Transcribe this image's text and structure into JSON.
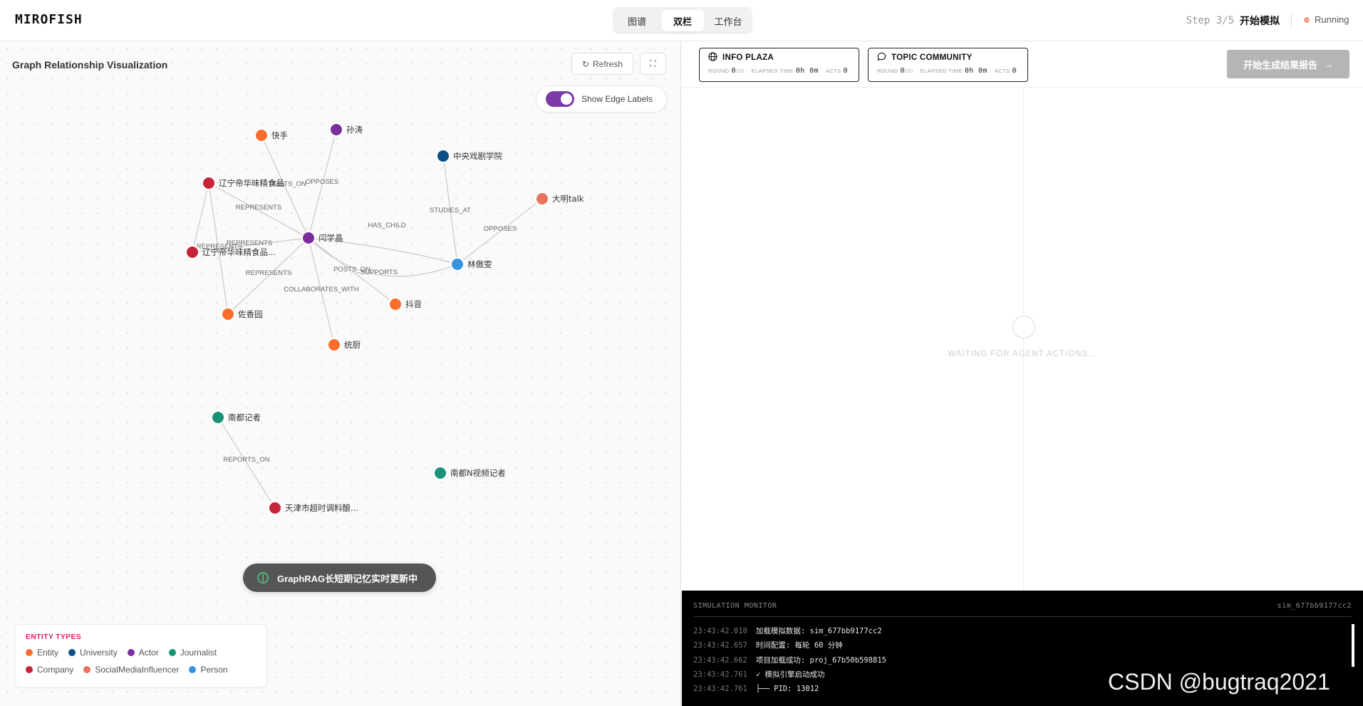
{
  "header": {
    "logo": "MIROFISH",
    "tabs": [
      {
        "label": "图谱"
      },
      {
        "label": "双栏"
      },
      {
        "label": "工作台"
      }
    ],
    "step_number": "Step 3/5",
    "step_name": "开始模拟",
    "status": "Running",
    "status_color": "#f5a08a"
  },
  "graph_panel": {
    "title": "Graph Relationship Visualization",
    "refresh_label": "Refresh",
    "refresh_icon": "refresh-icon",
    "fullscreen_icon": "fullscreen-icon",
    "edge_labels_toggle": "Show Edge Labels",
    "edge_labels_on": true,
    "nodes": [
      {
        "id": "kuaishou",
        "label": "快手",
        "type": "Entity",
        "color": "#fa6d2c"
      },
      {
        "id": "suntao",
        "label": "孙涛",
        "type": "Actor",
        "color": "#7b2d9c"
      },
      {
        "id": "liaoning1",
        "label": "辽宁帝华味精食品",
        "type": "Company",
        "color": "#c7243a"
      },
      {
        "id": "liaoning2",
        "label": "辽宁帝华味精食品...",
        "type": "Company",
        "color": "#c7243a"
      },
      {
        "id": "yanxueju",
        "label": "闫学晶",
        "type": "Actor",
        "color": "#7b2d9c"
      },
      {
        "id": "zhongxi",
        "label": "中央戏剧学院",
        "type": "University",
        "color": "#0b4f8a"
      },
      {
        "id": "daming",
        "label": "大明talk",
        "type": "SocialMediaInfluencer",
        "color": "#e8725a"
      },
      {
        "id": "linjiaowen",
        "label": "林傲雯",
        "type": "Person",
        "color": "#3593e0"
      },
      {
        "id": "douyin",
        "label": "抖音",
        "type": "Entity",
        "color": "#fa6d2c"
      },
      {
        "id": "zuoxiangyuan",
        "label": "佐香园",
        "type": "Entity",
        "color": "#fa6d2c"
      },
      {
        "id": "tongchu",
        "label": "统厨",
        "type": "Entity",
        "color": "#fa6d2c"
      },
      {
        "id": "nandu",
        "label": "南都记者",
        "type": "Journalist",
        "color": "#1a9277"
      },
      {
        "id": "nanduN",
        "label": "南都N视频记者",
        "type": "Journalist",
        "color": "#1a9277"
      },
      {
        "id": "tianjin",
        "label": "天津市超时调料酿...",
        "type": "Company",
        "color": "#c7243a"
      }
    ],
    "edges": [
      {
        "source": "yanxueju",
        "target": "kuaishou",
        "label": "POSTS_ON"
      },
      {
        "source": "yanxueju",
        "target": "suntao",
        "label": "OPPOSES"
      },
      {
        "source": "yanxueju",
        "target": "liaoning1",
        "label": "REPRESENTS"
      },
      {
        "source": "yanxueju",
        "target": "liaoning2",
        "label": "REPRESENTS"
      },
      {
        "source": "liaoning1",
        "target": "liaoning2",
        "label": "REPRESENTS"
      },
      {
        "source": "yanxueju",
        "target": "zuoxiangyuan",
        "label": "REPRESENTS"
      },
      {
        "source": "liaoning1",
        "target": "zuoxiangyuan",
        "label": ""
      },
      {
        "source": "yanxueju",
        "target": "linjiaowen",
        "label": "HAS_CHILD"
      },
      {
        "source": "yanxueju",
        "target": "douyin",
        "label": "POSTS_ON"
      },
      {
        "source": "yanxueju",
        "target": "tongchu",
        "label": "COLLABORATES_WITH"
      },
      {
        "source": "yanxueju",
        "target": "linjiaowen",
        "label": "SUPPORTS"
      },
      {
        "source": "linjiaowen",
        "target": "zhongxi",
        "label": "STUDIES_AT"
      },
      {
        "source": "linjiaowen",
        "target": "daming",
        "label": "OPPOSES"
      },
      {
        "source": "nandu",
        "target": "tianjin",
        "label": "REPORTS_ON"
      }
    ],
    "toast": "GraphRAG长短期记忆实时更新中",
    "legend": {
      "title": "ENTITY TYPES",
      "items": [
        {
          "label": "Entity",
          "color": "#fa6d2c"
        },
        {
          "label": "University",
          "color": "#0b4f8a"
        },
        {
          "label": "Actor",
          "color": "#7b2d9c"
        },
        {
          "label": "Journalist",
          "color": "#1a9277"
        },
        {
          "label": "Company",
          "color": "#c7243a"
        },
        {
          "label": "SocialMediaInfluencer",
          "color": "#e8725a"
        },
        {
          "label": "Person",
          "color": "#3593e0"
        }
      ]
    }
  },
  "simulation_panel": {
    "platforms": [
      {
        "name": "INFO PLAZA",
        "icon": "globe-icon",
        "round_label": "ROUND",
        "round_value": "0",
        "round_total": "/20",
        "elapsed_label": "ELAPSED TIME",
        "elapsed_value": "0h 0m",
        "acts_label": "ACTS",
        "acts_value": "0"
      },
      {
        "name": "TOPIC COMMUNITY",
        "icon": "chat-bubble-icon",
        "round_label": "ROUND",
        "round_value": "0",
        "round_total": "/20",
        "elapsed_label": "ELAPSED TIME",
        "elapsed_value": "0h 0m",
        "acts_label": "ACTS",
        "acts_value": "0"
      }
    ],
    "report_button": "开始生成结果报告",
    "report_arrow": "→",
    "waiting_text": "WAITING FOR AGENT ACTIONS..."
  },
  "terminal": {
    "title": "SIMULATION MONITOR",
    "sim_id": "sim_677bb9177cc2",
    "lines": [
      {
        "time": "23:43:42.010",
        "msg": "加载模拟数据: sim_677bb9177cc2"
      },
      {
        "time": "23:43:42.657",
        "msg": "时间配置: 每轮 60 分钟"
      },
      {
        "time": "23:43:42.662",
        "msg": "项目加载成功: proj_67b50b598815"
      },
      {
        "time": "23:43:42.761",
        "msg": "✓ 模拟引擎启动成功"
      },
      {
        "time": "23:43:42.761",
        "msg": "├── PID: 13012"
      }
    ]
  },
  "watermark": "CSDN @bugtraq2021"
}
